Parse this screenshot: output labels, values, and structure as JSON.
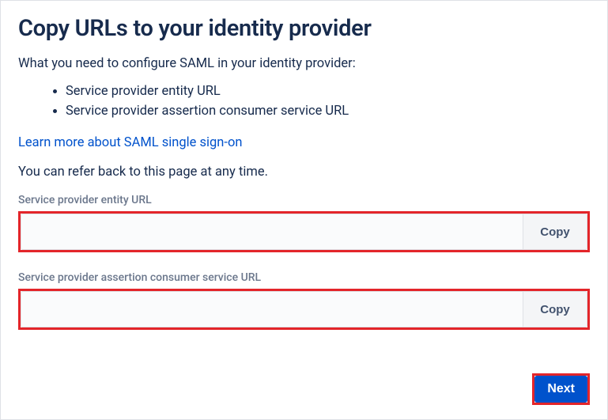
{
  "heading": "Copy URLs to your identity provider",
  "intro": "What you need to configure SAML in your identity provider:",
  "bullets": [
    "Service provider entity URL",
    "Service provider assertion consumer service URL"
  ],
  "learn_more": "Learn more about SAML single sign-on",
  "refer_text": "You can refer back to this page at any time.",
  "fields": {
    "entity": {
      "label": "Service provider entity URL",
      "value": "",
      "copy": "Copy"
    },
    "acs": {
      "label": "Service provider assertion consumer service URL",
      "value": "",
      "copy": "Copy"
    }
  },
  "next_label": "Next"
}
